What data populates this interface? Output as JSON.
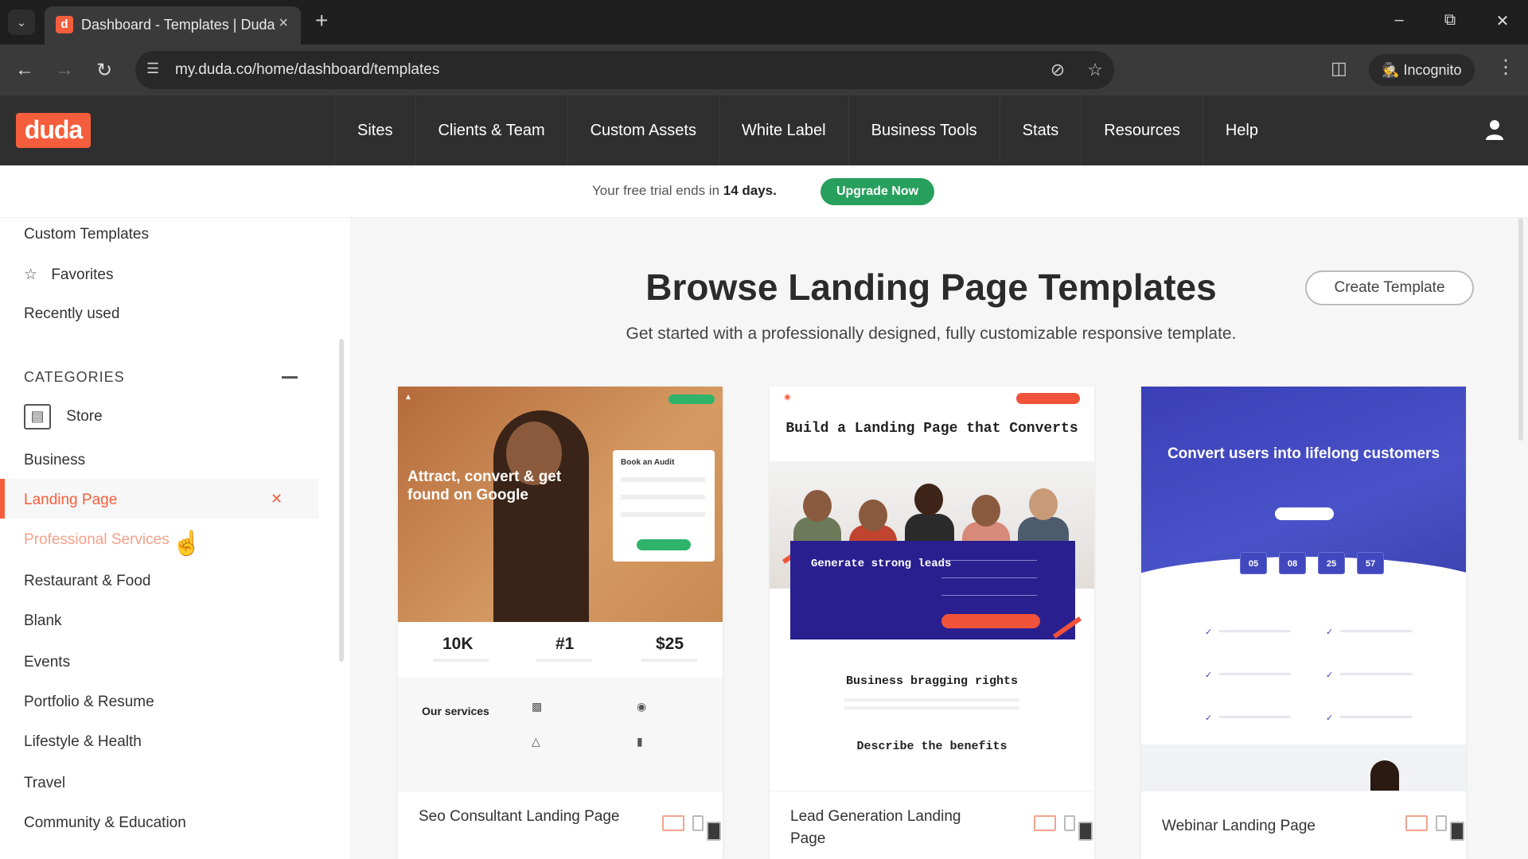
{
  "browser": {
    "tab_title": "Dashboard - Templates | Duda",
    "tab_favicon": "d",
    "url": "my.duda.co/home/dashboard/templates",
    "incognito_label": "Incognito"
  },
  "app": {
    "logo": "duda",
    "nav": [
      "Sites",
      "Clients & Team",
      "Custom Assets",
      "White Label",
      "Business Tools",
      "Stats",
      "Resources",
      "Help"
    ]
  },
  "trial": {
    "text_before": "Your free trial ends in ",
    "days": "14 days.",
    "upgrade_label": "Upgrade Now"
  },
  "sidebar": {
    "top_items": [
      "Custom Templates",
      "Favorites",
      "Recently used"
    ],
    "categories_heading": "CATEGORIES",
    "categories": [
      "Store",
      "Business",
      "Landing Page",
      "Professional Services",
      "Restaurant & Food",
      "Blank",
      "Events",
      "Portfolio & Resume",
      "Lifestyle & Health",
      "Travel",
      "Community & Education"
    ],
    "active_category": "Landing Page"
  },
  "main": {
    "title": "Browse Landing Page Templates",
    "subtitle": "Get started with a professionally designed, fully customizable responsive template.",
    "create_label": "Create Template"
  },
  "cards": [
    {
      "name": "Seo Consultant Landing Page",
      "preview": {
        "headline": "Attract, convert & get found on Google",
        "form_title": "Book an Audit",
        "stats": [
          "10K",
          "#1",
          "$25"
        ],
        "services_title": "Our services"
      }
    },
    {
      "name": "Lead Generation Landing Page",
      "preview": {
        "headline": "Build a Landing Page that Converts",
        "lead_text": "Generate strong leads",
        "bragging": "Business bragging rights",
        "describe": "Describe the benefits"
      }
    },
    {
      "name": "Webinar Landing Page",
      "preview": {
        "headline": "Convert users into lifelong customers",
        "counters": [
          "05",
          "08",
          "25",
          "57"
        ]
      }
    }
  ],
  "colors": {
    "brand": "#f55e3c",
    "upgrade": "#27a05d"
  }
}
